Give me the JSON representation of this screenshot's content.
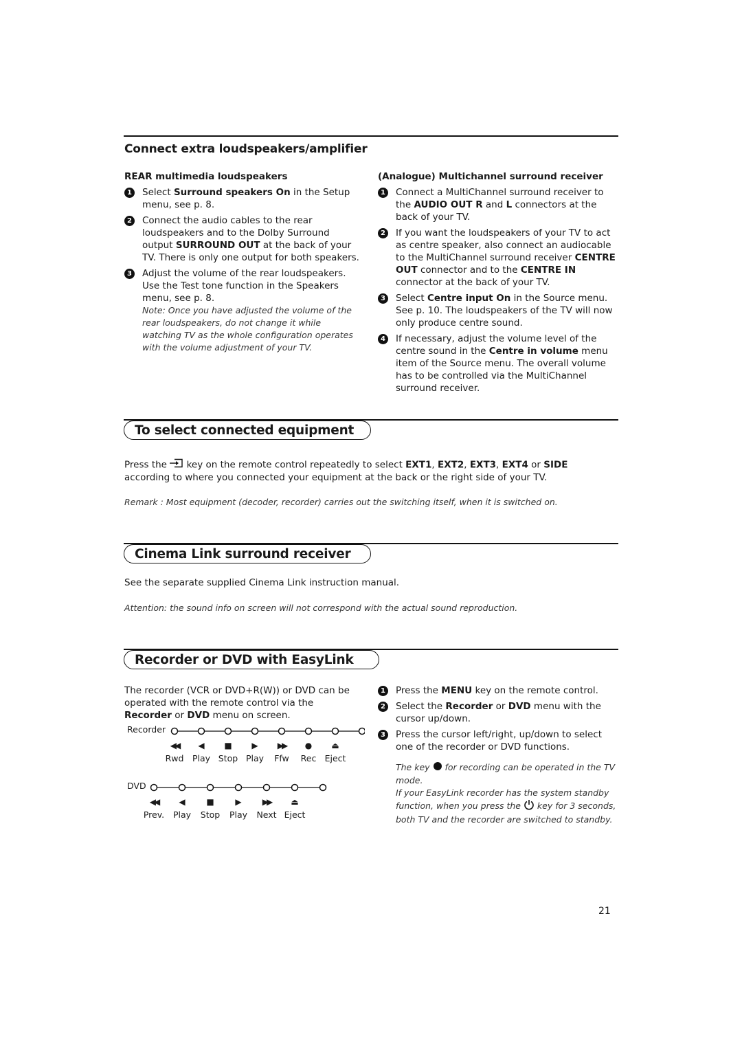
{
  "page_number": "21",
  "sections": {
    "extra_speakers": {
      "title": "Connect extra loudspeakers/amplifier",
      "rear": {
        "heading_bold": "REAR",
        "heading_rest": " multimedia loudspeakers",
        "steps": [
          {
            "num": "1",
            "parts": [
              "Select ",
              "Surround speakers On",
              " in the Setup menu, see p. 8."
            ]
          },
          {
            "num": "2",
            "parts": [
              "Connect the audio cables to the rear loudspeakers and to the Dolby Surround output ",
              "SURROUND OUT",
              " at the back of your TV. There is only one output for both speakers."
            ]
          },
          {
            "num": "3",
            "parts": [
              "Adjust the volume of the rear loudspeakers. Use the Test tone function in the Speakers menu, see p. 8."
            ]
          }
        ],
        "note": "Note: Once you have adjusted the volume of the rear loudspeakers, do not change it while watching TV as the whole configuration operates with the volume adjustment of your TV."
      },
      "multichannel": {
        "heading": "(Analogue) Multichannel surround receiver",
        "steps": [
          {
            "num": "1",
            "parts": [
              "Connect a MultiChannel surround receiver to the ",
              "AUDIO OUT R",
              " and ",
              "L",
              " connectors at the back of your TV."
            ]
          },
          {
            "num": "2",
            "parts": [
              "If you want the loudspeakers of your TV to act as centre speaker, also connect an audiocable to the MultiChannel surround receiver ",
              "CENTRE OUT",
              " connector and to the ",
              "CENTRE IN",
              " connector at the back of your TV."
            ]
          },
          {
            "num": "3",
            "parts": [
              "Select ",
              "Centre input On",
              " in the Source menu. See p. 10. The loudspeakers of the TV will now only produce centre sound."
            ]
          },
          {
            "num": "4",
            "parts": [
              "If necessary, adjust the volume level of the centre sound in the ",
              "Centre in volume",
              " menu item of the Source menu. The overall volume has to be controlled via the MultiChannel surround receiver."
            ]
          }
        ]
      }
    },
    "select_equipment": {
      "title": "To select connected equipment",
      "text_pre": "Press the ",
      "key_icon": "source-input-icon",
      "text_mid": " key on the remote control repeatedly to select ",
      "sources": [
        "EXT1",
        "EXT2",
        "EXT3",
        "EXT4"
      ],
      "or": " or ",
      "side": "SIDE",
      "text_post": "according to where you connected your equipment at the back or the right side of your TV.",
      "remark": "Remark : Most equipment (decoder, recorder) carries out the switching itself, when it is switched on."
    },
    "cinema_link": {
      "title": "Cinema Link surround receiver",
      "text": "See the separate supplied Cinema Link instruction manual.",
      "attention": "Attention: the sound info on screen will not correspond with the actual sound reproduction."
    },
    "easylink": {
      "title": "Recorder or DVD with EasyLink",
      "intro_parts": [
        "The recorder (VCR or DVD+R(W)) or DVD can be operated with the remote control via the ",
        "Recorder",
        " or ",
        "DVD",
        " menu on screen."
      ],
      "recorder_diagram": {
        "label": "Recorder",
        "buttons": [
          {
            "icon": "rewind-icon",
            "glyph": "◀◀",
            "label": "Rwd"
          },
          {
            "icon": "play-reverse-icon",
            "glyph": "◀",
            "label": "Play"
          },
          {
            "icon": "stop-icon",
            "glyph": "■",
            "label": "Stop"
          },
          {
            "icon": "play-icon",
            "glyph": "▶",
            "label": "Play"
          },
          {
            "icon": "fast-forward-icon",
            "glyph": "▶▶",
            "label": "Ffw"
          },
          {
            "icon": "record-icon",
            "glyph": "●",
            "label": "Rec"
          },
          {
            "icon": "eject-icon",
            "glyph": "⏏",
            "label": "Eject"
          }
        ]
      },
      "dvd_diagram": {
        "label": "DVD",
        "buttons": [
          {
            "icon": "previous-icon",
            "glyph": "◀◀",
            "label": "Prev."
          },
          {
            "icon": "play-reverse-icon",
            "glyph": "◀",
            "label": "Play"
          },
          {
            "icon": "stop-icon",
            "glyph": "■",
            "label": "Stop"
          },
          {
            "icon": "play-icon",
            "glyph": "▶",
            "label": "Play"
          },
          {
            "icon": "next-icon",
            "glyph": "▶▶",
            "label": "Next"
          },
          {
            "icon": "eject-icon",
            "glyph": "⏏",
            "label": "Eject"
          }
        ]
      },
      "steps": [
        {
          "num": "1",
          "parts": [
            "Press the ",
            "MENU",
            " key on the remote control."
          ]
        },
        {
          "num": "2",
          "parts": [
            "Select the ",
            "Recorder",
            " or ",
            "DVD",
            " menu with the cursor up/down."
          ]
        },
        {
          "num": "3",
          "parts": [
            "Press the cursor left/right, up/down to select one of the recorder or DVD functions."
          ]
        }
      ],
      "note1_pre": "The key ",
      "note1_post": " for recording can be operated in the TV mode.",
      "note2_pre": "If your EasyLink recorder has the system standby function, when you press the ",
      "note2_post": " key for 3 seconds, both TV and the recorder are switched to standby."
    }
  }
}
